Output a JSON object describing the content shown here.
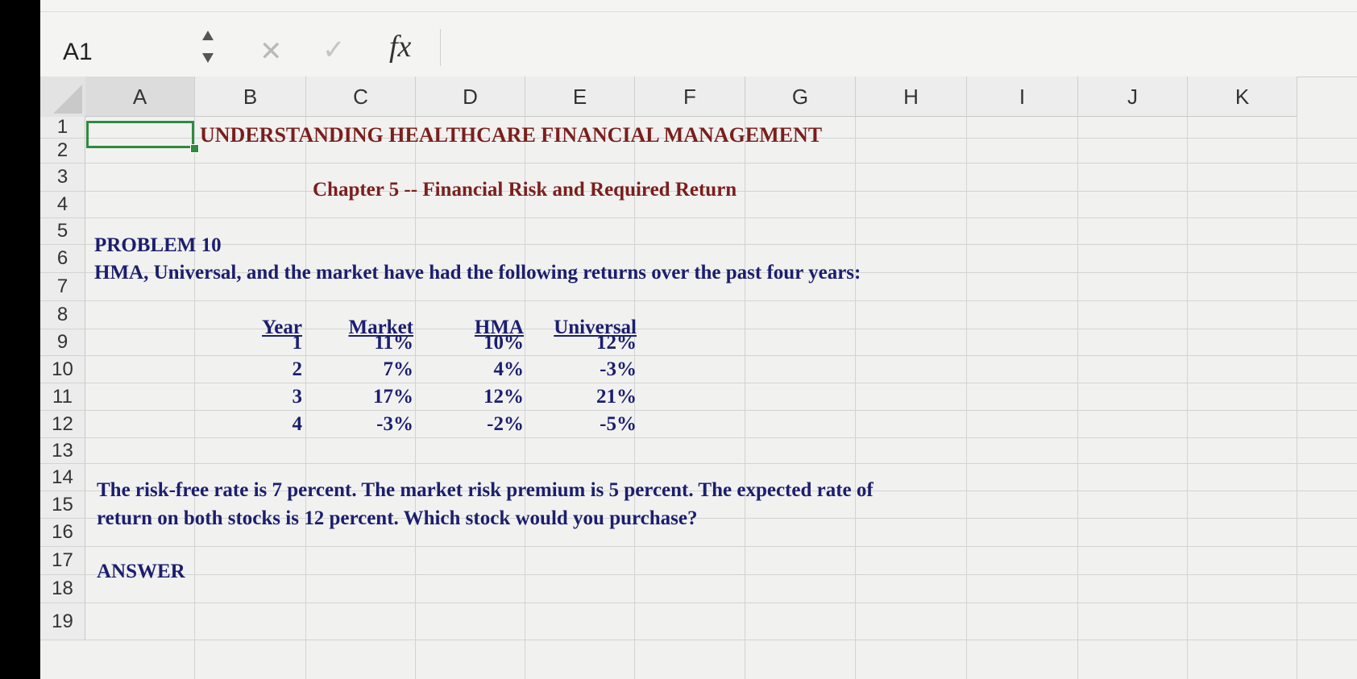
{
  "formula_bar": {
    "name_box": "A1",
    "fx_label": "fx",
    "formula_value": ""
  },
  "columns": [
    "A",
    "B",
    "C",
    "D",
    "E",
    "F",
    "G",
    "H",
    "I",
    "J",
    "K"
  ],
  "rows": [
    "1",
    "2",
    "3",
    "4",
    "5",
    "6",
    "7",
    "8",
    "9",
    "10",
    "11",
    "12",
    "13",
    "14",
    "15",
    "16",
    "17",
    "18",
    "19"
  ],
  "cells": {
    "title": "UNDERSTANDING HEALTHCARE FINANCIAL MANAGEMENT",
    "chapter": "Chapter 5 -- Financial Risk and Required Return",
    "problem": "PROBLEM 10",
    "intro": "HMA, Universal, and the market have had the following returns over the past four years:",
    "table_headers": [
      "Year",
      "Market",
      "HMA",
      "Universal"
    ],
    "table_rows": [
      [
        "1",
        "11%",
        "10%",
        "12%"
      ],
      [
        "2",
        "7%",
        "4%",
        "-3%"
      ],
      [
        "3",
        "17%",
        "12%",
        "21%"
      ],
      [
        "4",
        "-3%",
        "-2%",
        "-5%"
      ]
    ],
    "question_line1": "The risk-free rate is 7 percent. The market risk premium is 5 percent. The expected rate of",
    "question_line2": "return on both stocks is 12 percent. Which stock would you purchase?",
    "answer_label": "ANSWER"
  },
  "colors": {
    "selection": "#2e8b3f",
    "text_blue": "#1b1e6e",
    "title_red": "#7a1f1c"
  }
}
